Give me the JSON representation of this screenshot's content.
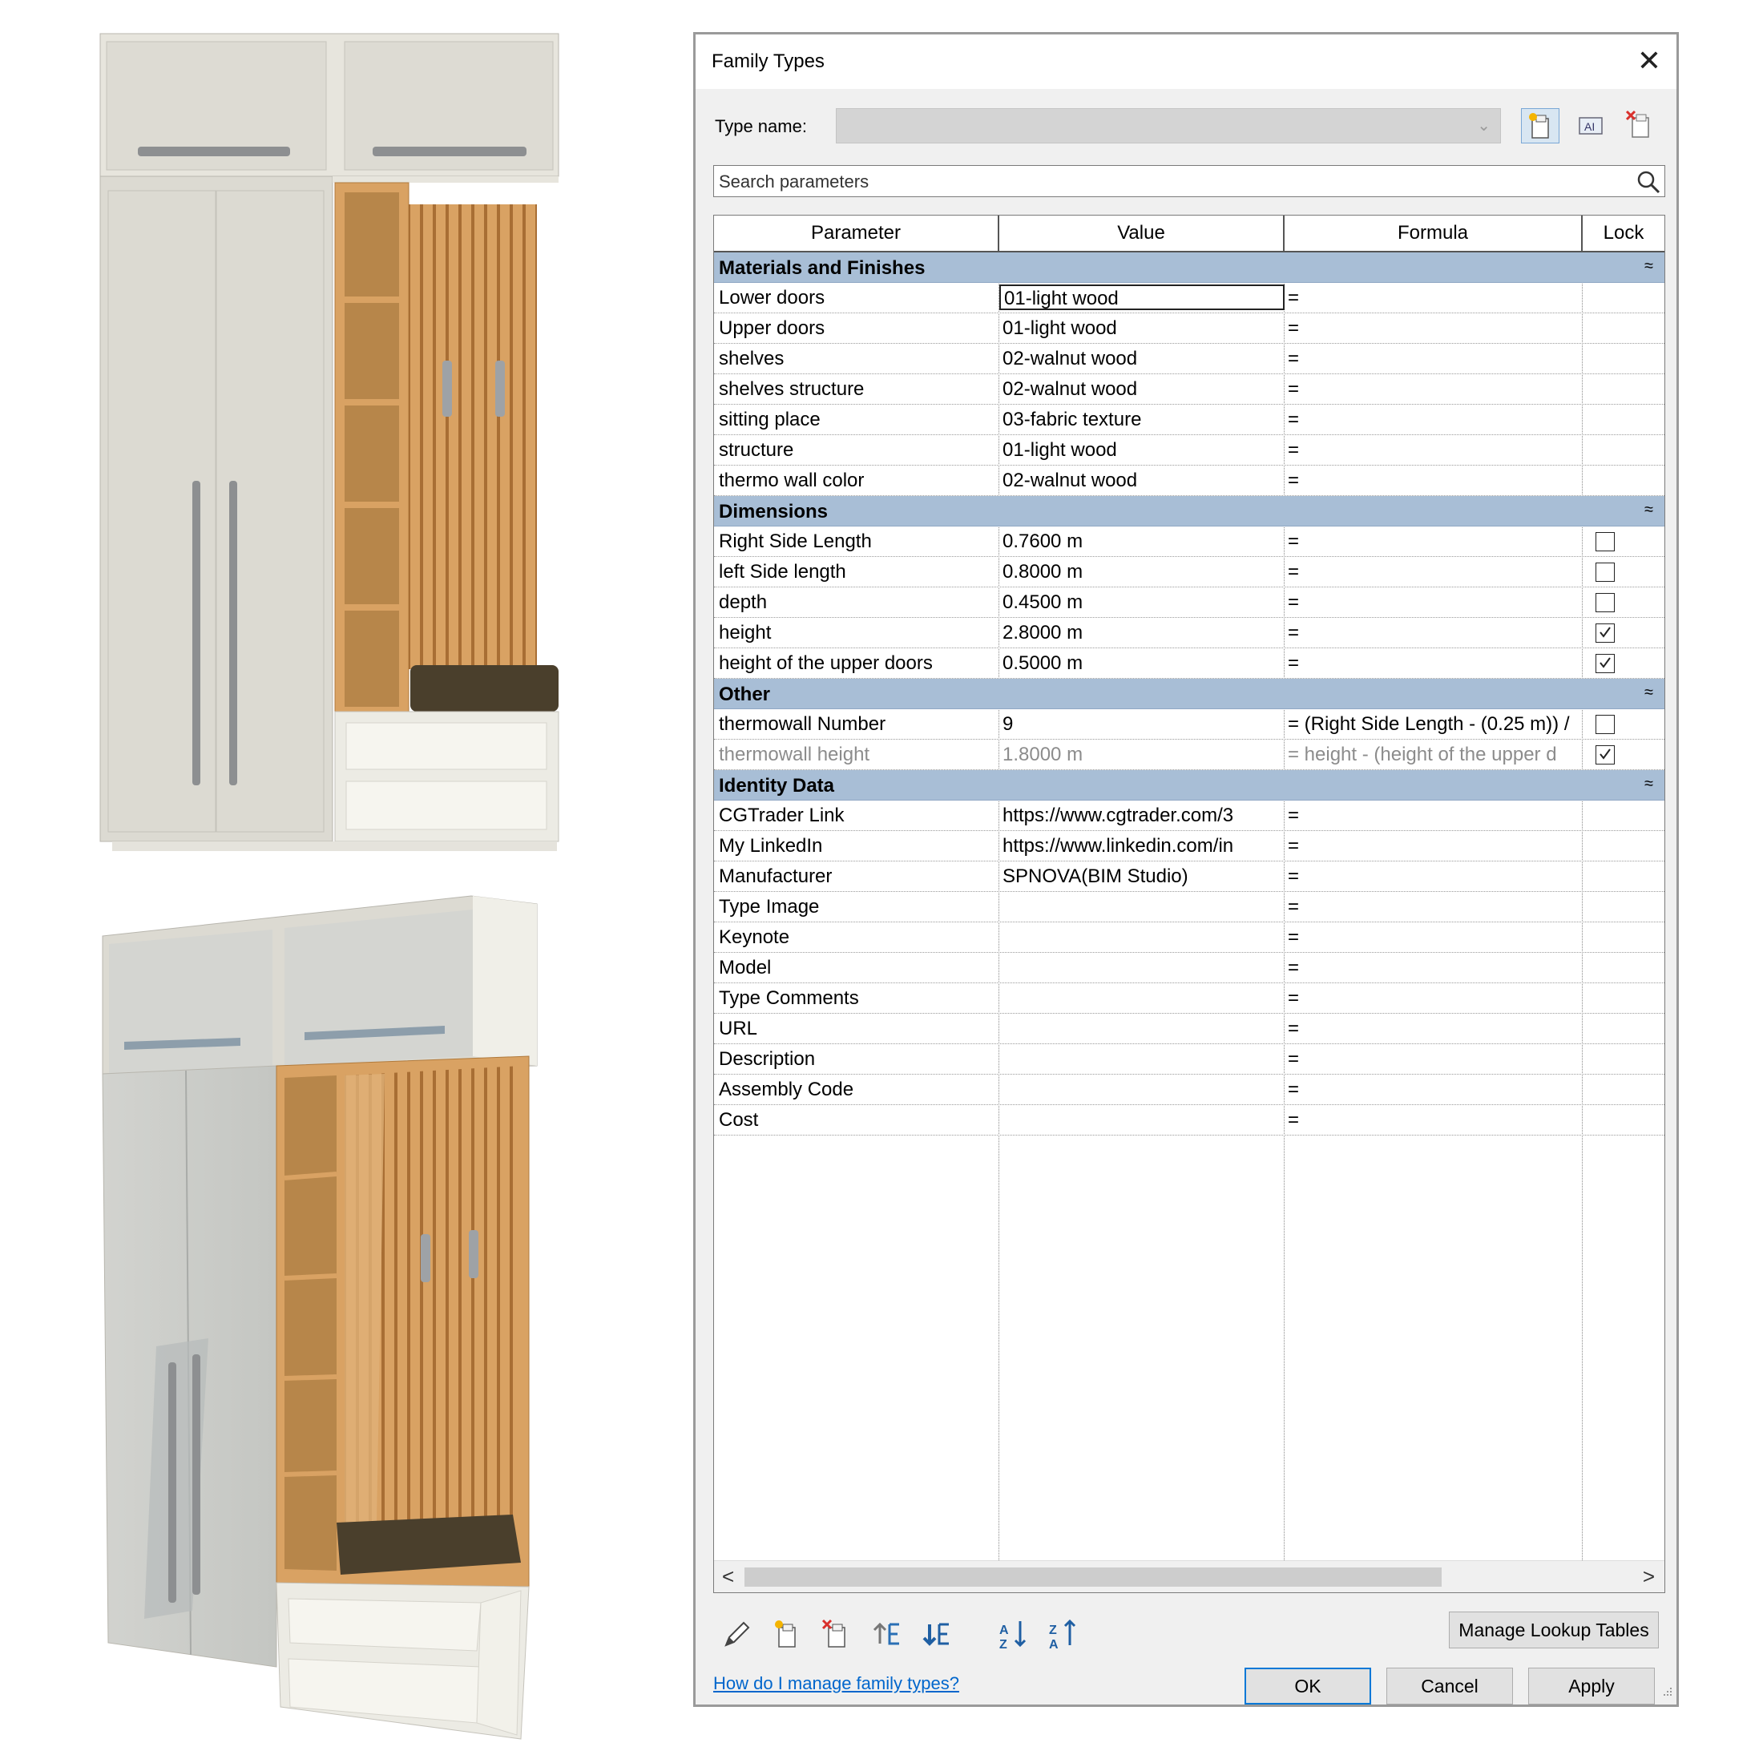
{
  "dialog": {
    "title": "Family Types",
    "type_name_label": "Type name:",
    "type_name_value": "",
    "search_placeholder": "Search parameters",
    "columns": [
      "Parameter",
      "Value",
      "Formula",
      "Lock"
    ],
    "groups": [
      {
        "name": "Materials and Finishes",
        "rows": [
          {
            "param": "Lower doors",
            "value": "01-light wood",
            "formula": "="
          },
          {
            "param": "Upper doors",
            "value": "01-light wood",
            "formula": "="
          },
          {
            "param": "shelves",
            "value": "02-walnut wood",
            "formula": "="
          },
          {
            "param": "shelves structure",
            "value": "02-walnut wood",
            "formula": "="
          },
          {
            "param": "sitting place",
            "value": "03-fabric texture",
            "formula": "="
          },
          {
            "param": "structure",
            "value": "01-light wood",
            "formula": "="
          },
          {
            "param": "thermo wall color",
            "value": "02-walnut wood",
            "formula": "="
          }
        ]
      },
      {
        "name": "Dimensions",
        "rows": [
          {
            "param": "Right Side Length",
            "value": "0.7600 m",
            "formula": "=",
            "lock": false
          },
          {
            "param": "left Side length",
            "value": "0.8000 m",
            "formula": "=",
            "lock": false
          },
          {
            "param": "depth",
            "value": "0.4500 m",
            "formula": "=",
            "lock": false
          },
          {
            "param": "height",
            "value": "2.8000 m",
            "formula": "=",
            "lock": true
          },
          {
            "param": "height of the upper doors",
            "value": "0.5000 m",
            "formula": "=",
            "lock": true
          }
        ]
      },
      {
        "name": "Other",
        "rows": [
          {
            "param": "thermowall Number",
            "value": "9",
            "formula": "= (Right Side Length - (0.25 m)) /",
            "lock": false
          },
          {
            "param": "thermowall height",
            "value": "1.8000 m",
            "formula": "= height - (height of the upper d",
            "lock": true
          }
        ]
      },
      {
        "name": "Identity Data",
        "rows": [
          {
            "param": "CGTrader Link",
            "value": "https://www.cgtrader.com/3",
            "formula": "="
          },
          {
            "param": "My LinkedIn",
            "value": "https://www.linkedin.com/in",
            "formula": "="
          },
          {
            "param": "Manufacturer",
            "value": "SPNOVA(BIM Studio)",
            "formula": "="
          },
          {
            "param": "Type Image",
            "value": "",
            "formula": "="
          },
          {
            "param": "Keynote",
            "value": "",
            "formula": "="
          },
          {
            "param": "Model",
            "value": "",
            "formula": "="
          },
          {
            "param": "Type Comments",
            "value": "",
            "formula": "="
          },
          {
            "param": "URL",
            "value": "",
            "formula": "="
          },
          {
            "param": "Description",
            "value": "",
            "formula": "="
          },
          {
            "param": "Assembly Code",
            "value": "",
            "formula": "="
          },
          {
            "param": "Cost",
            "value": "",
            "formula": "="
          }
        ]
      }
    ],
    "collapse_glyph": "≈",
    "manage_lookup_label": "Manage Lookup Tables",
    "help_link": "How do I manage family types?",
    "ok_label": "OK",
    "cancel_label": "Cancel",
    "apply_label": "Apply",
    "close_glyph": "✕",
    "scroll_left": "<",
    "scroll_right": ">"
  },
  "icons": {
    "toolbar": [
      "new-type-icon",
      "rename-type-icon",
      "delete-type-icon"
    ],
    "bottom": [
      "edit-parameter-icon",
      "new-parameter-icon",
      "delete-parameter-icon",
      "move-up-icon",
      "move-down-icon",
      "sort-ascending-icon",
      "sort-descending-icon"
    ]
  },
  "colors": {
    "group_header": "#a8bed6",
    "wood": "#d6a66a",
    "cabinet": "#dcdad2",
    "cushion": "#4a3f2c",
    "link": "#0066cc",
    "default_button_border": "#0078d7"
  }
}
